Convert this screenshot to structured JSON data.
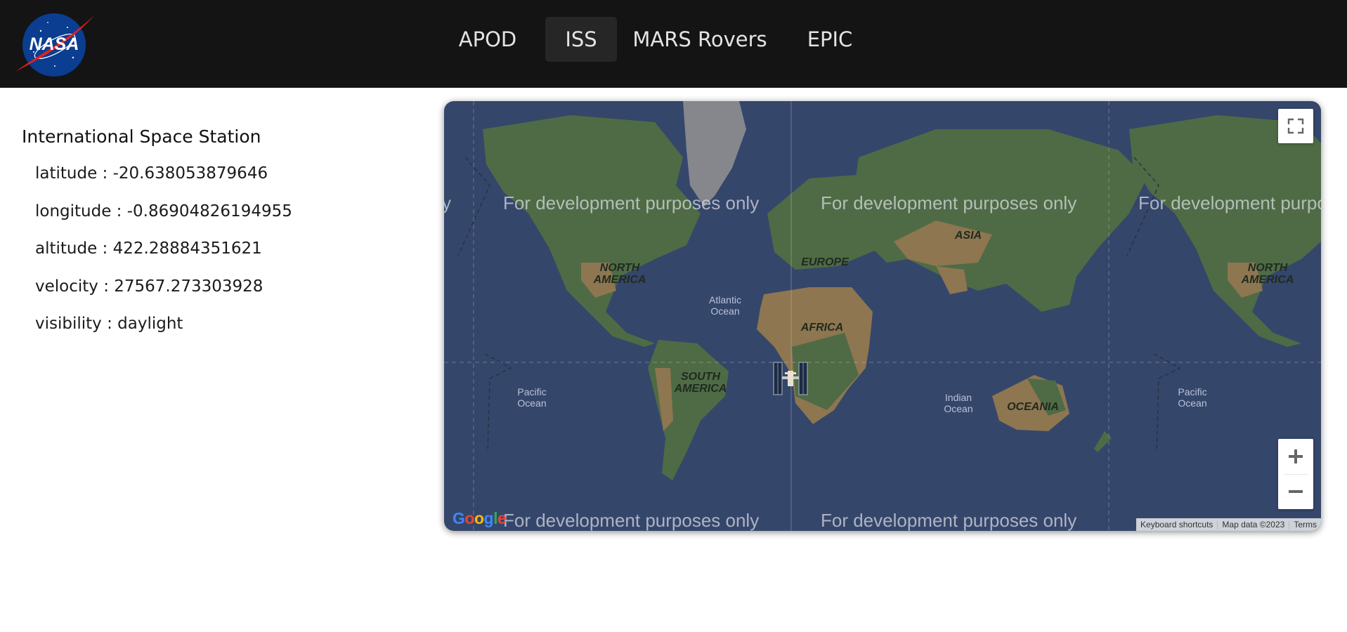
{
  "header": {
    "logo_text": "NASA",
    "nav": [
      {
        "label": "APOD",
        "active": false
      },
      {
        "label": "ISS",
        "active": true
      },
      {
        "label": "MARS Rovers",
        "active": false
      },
      {
        "label": "EPIC",
        "active": false
      }
    ]
  },
  "iss": {
    "title": "International Space Station",
    "rows": [
      "latitude : -20.638053879646",
      "longitude : -0.86904826194955",
      "altitude : 422.28884351621",
      "velocity : 27567.273303928",
      "visibility : daylight"
    ]
  },
  "map": {
    "watermark": "For development purposes only",
    "continents": {
      "north_america": "NORTH AMERICA",
      "south_america": "SOUTH AMERICA",
      "europe": "EUROPE",
      "africa": "AFRICA",
      "asia": "ASIA",
      "oceania": "OCEANIA"
    },
    "oceans": {
      "atlantic": "Atlantic Ocean",
      "pacific": "Pacific Ocean",
      "indian": "Indian Ocean"
    },
    "google_logo": "Google",
    "attribution": {
      "keyboard": "Keyboard shortcuts",
      "map_data": "Map data ©2023",
      "terms": "Terms"
    },
    "marker_icon": "iss-icon",
    "colors": {
      "ocean": "#35466b",
      "land": "#4e6b45",
      "desert": "#8d7650",
      "ice": "#8a8d93",
      "header": "#141414"
    }
  }
}
